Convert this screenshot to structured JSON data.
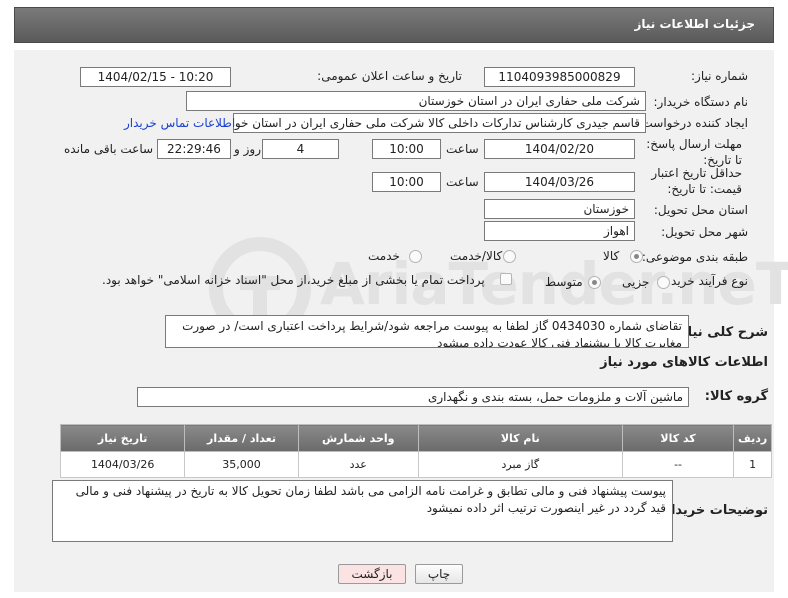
{
  "header": {
    "title": "جزئیات اطلاعات نیاز"
  },
  "watermark": {
    "text": "AriaTender.neT"
  },
  "fields": {
    "need_number": {
      "label": "شماره نیاز:",
      "value": "1104093985000829"
    },
    "announce_datetime": {
      "label": "تاریخ و ساعت اعلان عمومی:",
      "value": "1404/02/15 - 10:20"
    },
    "buyer_org": {
      "label": "نام دستگاه خریدار:",
      "value": "شرکت ملی حفاری ایران در استان خوزستان"
    },
    "requester": {
      "label": "ایجاد کننده درخواست:",
      "value": "قاسم جیدری کارشناس تدارکات داخلی کالا شرکت ملی حفاری ایران در استان خوزستان",
      "contact_link": "اطلاعات تماس خریدار"
    },
    "reply_deadline": {
      "label": "مهلت ارسال پاسخ: تا تاریخ:",
      "date": "1404/02/20",
      "time_label": "ساعت",
      "time": "10:00",
      "days": "4",
      "days_label": "روز و",
      "remaining": "22:29:46",
      "remaining_label": "ساعت باقی مانده"
    },
    "price_validity": {
      "label": "حداقل تاریخ اعتبار قیمت: تا تاریخ:",
      "date": "1404/03/26",
      "time_label": "ساعت",
      "time": "10:00"
    },
    "delivery_province": {
      "label": "استان محل تحویل:",
      "value": "خوزستان"
    },
    "delivery_city": {
      "label": "شهر محل تحویل:",
      "value": "اهواز"
    },
    "category": {
      "label": "طبقه بندی موضوعی:",
      "options": [
        "کالا",
        "کالا/خدمت",
        "خدمت"
      ],
      "selected": "کالا"
    },
    "process_type": {
      "label": "نوع فرآیند خرید :",
      "options": [
        "جزیی",
        "متوسط"
      ],
      "selected": "متوسط",
      "payment_note": "پرداخت تمام یا بخشی از مبلغ خرید،از محل \"اسناد خزانه اسلامی\" خواهد بود."
    }
  },
  "description": {
    "label": "شرح کلی نیاز:",
    "text": "تقاضای شماره 0434030 گاز لطفا به پیوست مراجعه شود/شرایط پرداخت اعتباری است/ در صورت مغایرت کالا با پیشنهاد فنی کالا عودت داده میشود"
  },
  "goods_section": {
    "title": "اطلاعات کالاهای مورد نیاز"
  },
  "goods_group": {
    "label": "گروه کالا:",
    "value": "ماشین آلات و ملزومات حمل، بسته بندی و نگهداری"
  },
  "table": {
    "headers": [
      "ردیف",
      "کد کالا",
      "نام کالا",
      "واحد شمارش",
      "تعداد / مقدار",
      "تاریخ نیاز"
    ],
    "rows": [
      [
        "1",
        "--",
        "گاز مبرد",
        "عدد",
        "35,000",
        "1404/03/26"
      ]
    ]
  },
  "buyer_notes": {
    "label": "توضیحات خریدار:",
    "text": "پیوست پیشنهاد فنی و مالی تطابق و غرامت نامه الزامی می باشد لطفا زمان تحویل کالا به تاریخ در پیشنهاد فنی و مالی قید گردد در غیر اینصورت ترتیب اثر داده نمیشود"
  },
  "buttons": {
    "print": "چاپ",
    "back": "بازگشت"
  },
  "colors": {
    "header_bg": "#666666",
    "link": "#1a3fcf",
    "back_button_bg": "#fbe3e3",
    "panel_bg": "#f1f1f1"
  }
}
